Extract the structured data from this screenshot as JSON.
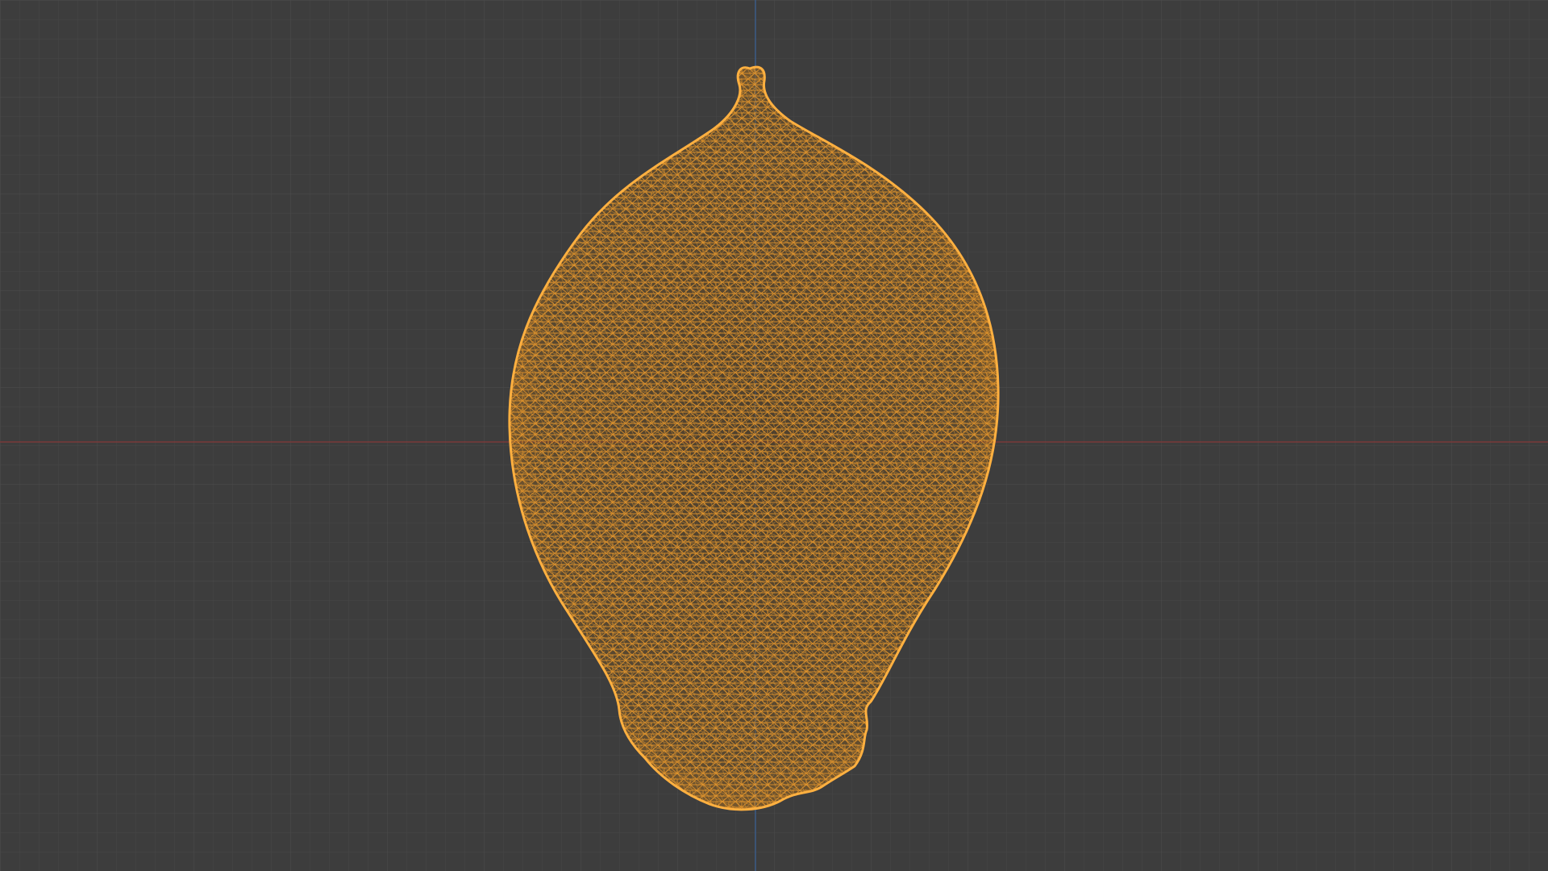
{
  "viewport": {
    "background_color": "#3d3d3d",
    "grid_minor_color": "#474747",
    "grid_major_color": "#505050",
    "x_axis_color": "#7a3a3a",
    "y_axis_color": "#3a5a85",
    "view_mode": "wireframe",
    "selected_object": {
      "wire_color": "#f0a030",
      "outline_color": "#ffb040"
    }
  }
}
